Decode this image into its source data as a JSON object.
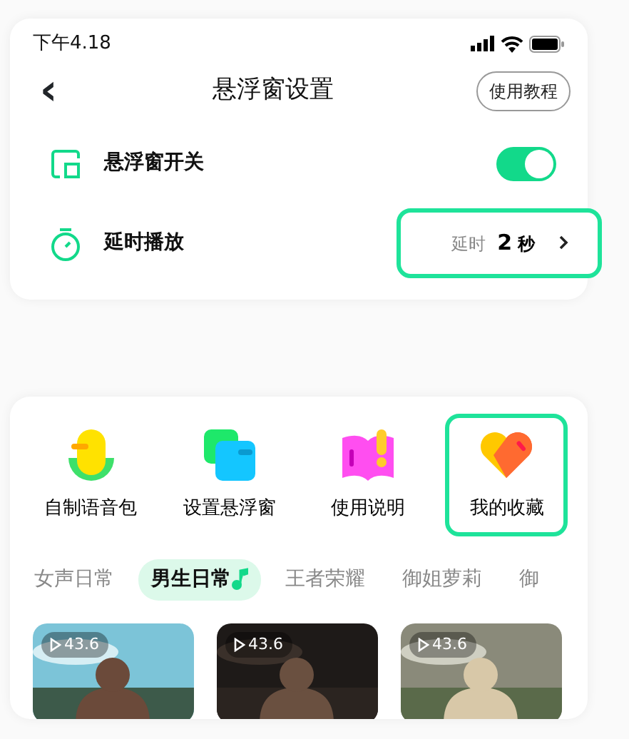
{
  "status_bar": {
    "time": "下午4.18"
  },
  "header": {
    "back": "‹",
    "title": "悬浮窗设置",
    "tutorial_button": "使用教程"
  },
  "settings": [
    {
      "kind": "toggle",
      "label": "悬浮窗开关",
      "on": true
    },
    {
      "kind": "value",
      "label": "延时播放",
      "prefix": "延时",
      "value": "2",
      "unit": "秒",
      "highlighted": true
    }
  ],
  "shortcuts": [
    {
      "label": "自制语音包",
      "highlighted": false
    },
    {
      "label": "设置悬浮窗",
      "highlighted": false
    },
    {
      "label": "使用说明",
      "highlighted": false
    },
    {
      "label": "我的收藏",
      "highlighted": true
    }
  ],
  "categories": [
    {
      "label": "女声日常",
      "selected": false
    },
    {
      "label": "男生日常",
      "selected": true
    },
    {
      "label": "王者荣耀",
      "selected": false
    },
    {
      "label": "御姐萝莉",
      "selected": false
    },
    {
      "label": "御",
      "selected": false
    }
  ],
  "cards": [
    {
      "plays": "43.6",
      "kind": "picture"
    },
    {
      "plays": "43.6",
      "kind": "picture"
    },
    {
      "plays": "43.6",
      "kind": "picture"
    }
  ]
}
